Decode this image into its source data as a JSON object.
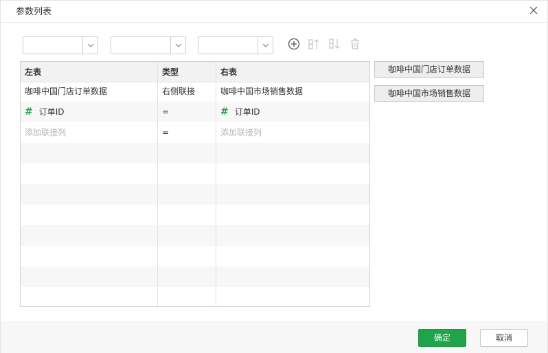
{
  "dialog": {
    "title": "参数列表",
    "ok_label": "确定",
    "cancel_label": "取消"
  },
  "selects": [
    {
      "value": ""
    },
    {
      "value": ""
    },
    {
      "value": ""
    }
  ],
  "toolbar": {
    "icons": [
      "add-circle-icon",
      "sort-ascending-icon",
      "sort-descending-icon",
      "delete-icon"
    ]
  },
  "grid": {
    "headers": {
      "left": "左表",
      "type": "类型",
      "right": "右表"
    },
    "rows": [
      {
        "left": "咖啡中国门店订单数据",
        "type": "右侧联接",
        "right": "咖啡中国市场销售数据"
      },
      {
        "left": "订单ID",
        "type": "=",
        "right": "订单ID"
      },
      {
        "left": "添加联接列",
        "type": "=",
        "right": "添加联接列"
      }
    ]
  },
  "tables": [
    {
      "label": "咖啡中国门店订单数据"
    },
    {
      "label": "咖啡中国市场销售数据"
    }
  ]
}
